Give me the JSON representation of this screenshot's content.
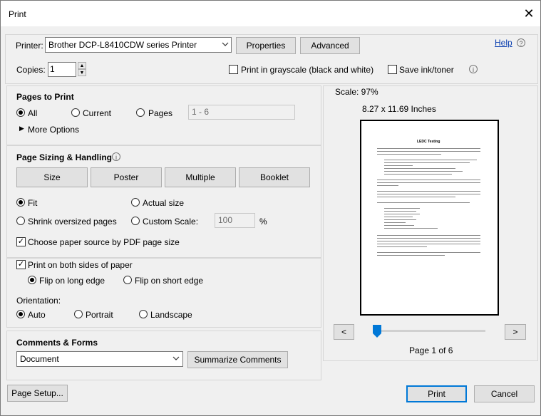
{
  "window": {
    "title": "Print",
    "close_glyph": "✕"
  },
  "printer": {
    "label": "Printer:",
    "selected": "Brother DCP-L8410CDW series Printer",
    "properties_label": "Properties",
    "advanced_label": "Advanced",
    "help_label": "Help",
    "copies_label": "Copies:",
    "copies_value": "1",
    "grayscale_label": "Print in grayscale (black and white)",
    "save_ink_label": "Save ink/toner"
  },
  "pages_to_print": {
    "title": "Pages to Print",
    "all_label": "All",
    "current_label": "Current",
    "pages_label": "Pages",
    "pages_range": "1 - 6",
    "more_options_label": "More Options"
  },
  "sizing": {
    "title": "Page Sizing & Handling",
    "tabs": [
      "Size",
      "Poster",
      "Multiple",
      "Booklet"
    ],
    "fit_label": "Fit",
    "actual_size_label": "Actual size",
    "shrink_label": "Shrink oversized pages",
    "custom_scale_label": "Custom Scale:",
    "custom_scale_value": "100",
    "percent": "%",
    "paper_source_label": "Choose paper source by PDF page size"
  },
  "duplex": {
    "both_sides_label": "Print on both sides of paper",
    "long_edge_label": "Flip on long edge",
    "short_edge_label": "Flip on short edge",
    "orientation_label": "Orientation:",
    "auto_label": "Auto",
    "portrait_label": "Portrait",
    "landscape_label": "Landscape"
  },
  "comments": {
    "title": "Comments & Forms",
    "selected": "Document",
    "summarize_label": "Summarize Comments"
  },
  "preview": {
    "scale_text": "Scale:  97%",
    "size_text": "8.27 x 11.69 Inches",
    "doc_title": "LEDC Testing",
    "prev_label": "<",
    "next_label": ">",
    "page_indicator": "Page 1 of 6",
    "slider_position": 0
  },
  "footer": {
    "page_setup_label": "Page Setup...",
    "print_label": "Print",
    "cancel_label": "Cancel"
  },
  "colors": {
    "accent": "#0078d7",
    "link": "#0a3fb0",
    "panel_border": "#d6d6d6"
  }
}
